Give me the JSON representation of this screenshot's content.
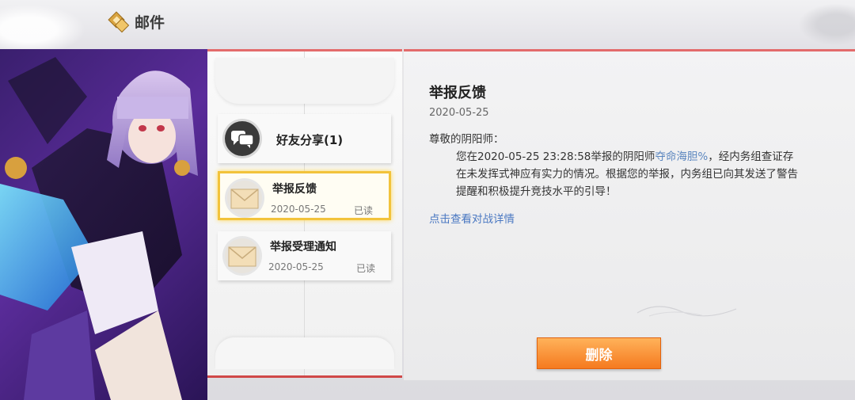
{
  "header": {
    "title": "邮件",
    "back_icon": "diamond-back-icon"
  },
  "mail_list": {
    "items": [
      {
        "name": "好友分享(1)",
        "icon": "chat-bubbles-icon"
      },
      {
        "name": "举报反馈",
        "date": "2020-05-25",
        "status": "已读",
        "icon": "envelope-icon",
        "selected": true
      },
      {
        "name": "举报受理通知",
        "date": "2020-05-25",
        "status": "已读",
        "icon": "envelope-icon"
      }
    ]
  },
  "detail": {
    "title": "举报反馈",
    "date": "2020-05-25",
    "greeting": "尊敬的阴阳师：",
    "body_before": "您在2020-05-25 23:28:58举报的阴阳师",
    "reported_name": "夺命海胆%",
    "body_after": "，经内务组查证存在未发挥式神应有实力的情况。根据您的举报，内务组已向其发送了警告提醒和积极提升竞技水平的引导！",
    "link_text": "点击查看对战详情",
    "delete_label": "删除"
  },
  "colors": {
    "accent_red": "#e36b6b",
    "link_blue": "#4a78c2",
    "button_orange": "#f57a1f",
    "selected_gold": "#f2c33b"
  }
}
